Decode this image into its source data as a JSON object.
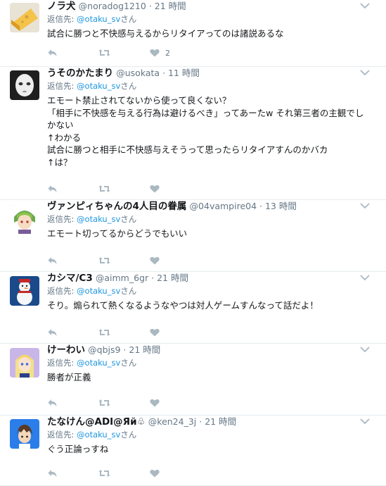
{
  "reply_prefix": "返信先:",
  "reply_suffix": "さん",
  "colors": {
    "link": "#1b95e0",
    "meta": "#657786",
    "icon": "#aab8c2",
    "divider": "#e6ecf0"
  },
  "tweets": [
    {
      "avatar_icon": "cheese-icon",
      "name": "ノラ犬",
      "handle": "@noradog1210",
      "time": "21 時間",
      "reply_to": "@otaku_sv",
      "lines": [
        "試合に勝つと不快感与えるからリタイアってのは諸説あるな"
      ],
      "like_count": "2"
    },
    {
      "avatar_icon": "doll-face-icon",
      "name": "うそのかたまり",
      "handle": "@usokata",
      "time": "11 時間",
      "reply_to": "@otaku_sv",
      "lines": [
        "エモート禁止されてないから使って良くない？",
        "「相手に不快感を与える行為は避けるべき」ってあーたw それ第三者の主観でし",
        "かない",
        "↑わかる",
        "試合に勝つと相手に不快感与えそうって思ったらリタイアすんのかバカ",
        "↑は？"
      ],
      "like_count": ""
    },
    {
      "avatar_icon": "anime-character-icon",
      "name": "ヴァンピィちゃんの4人目の眷属",
      "handle": "@04vampire04",
      "time": "13 時間",
      "reply_to": "@otaku_sv",
      "lines": [
        "エモート切ってるからどうでもいい"
      ],
      "like_count": ""
    },
    {
      "avatar_icon": "snowman-icon",
      "name": "カシマ/C3",
      "handle": "@aimm_6gr",
      "time": "21 時間",
      "reply_to": "@otaku_sv",
      "lines": [
        "そり。煽られて熱くなるようなやつは対人ゲームすんなって話だよ！"
      ],
      "like_count": ""
    },
    {
      "avatar_icon": "anime-girl-icon",
      "name": "けーわい",
      "handle": "@qbjs9",
      "time": "21 時間",
      "reply_to": "@otaku_sv",
      "lines": [
        "勝者が正義"
      ],
      "like_count": ""
    },
    {
      "avatar_icon": "anime-boy-icon",
      "name": "たなけん@ADI@Яй♧",
      "handle": "@ken24_3j",
      "time": "21 時間",
      "reply_to": "@otaku_sv",
      "lines": [
        "ぐう正論っすね"
      ],
      "like_count": ""
    }
  ]
}
